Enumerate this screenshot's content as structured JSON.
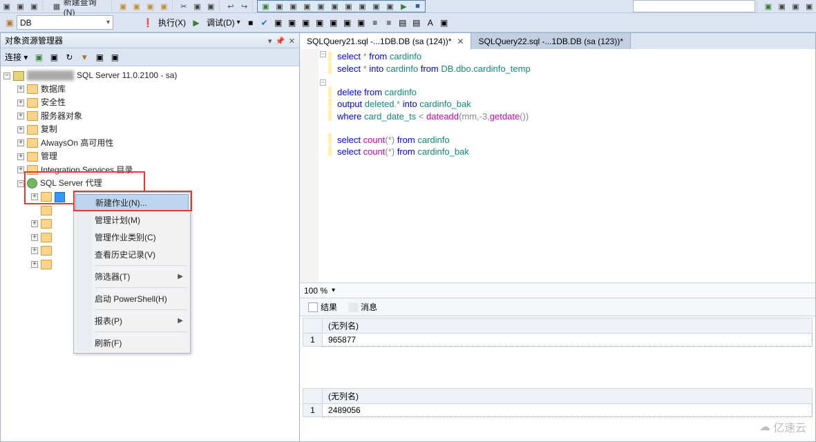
{
  "top_toolbar": {
    "new_query_label": "新建查询(N)",
    "dropdown_value": "DB",
    "execute_label": "执行(X)",
    "debug_label": "调试(D)"
  },
  "object_explorer": {
    "title": "对象资源管理器",
    "connect_label": "连接 ▾",
    "root_server": "SQL Server 11.0.2100 - sa)",
    "nodes": [
      "数据库",
      "安全性",
      "服务器对象",
      "复制",
      "AlwaysOn 高可用性",
      "管理",
      "Integration Services 目录",
      "SQL Server 代理"
    ]
  },
  "context_menu": {
    "items": {
      "new_job": "新建作业(N)...",
      "manage_plan": "管理计划(M)",
      "manage_category": "管理作业类别(C)",
      "history": "查看历史记录(V)",
      "filter": "筛选器(T)",
      "powershell": "启动 PowerShell(H)",
      "reports": "报表(P)",
      "refresh": "刷新(F)"
    }
  },
  "tabs": {
    "t1": "SQLQuery21.sql -...1DB.DB (sa (124))*",
    "t2": "SQLQuery22.sql -...1DB.DB (sa (123))*"
  },
  "code_tokens": {
    "l1": {
      "kw1": "select",
      "s": " * ",
      "kw2": "from",
      "id": " cardinfo"
    },
    "l2": {
      "kw1": "select",
      "s": " * ",
      "kw2": "into",
      "id1": " cardinfo ",
      "kw3": "from",
      "id2": " DB.dbo.cardinfo_temp"
    },
    "l3": {
      "kw1": "delete",
      "kw2": " from",
      "id": " cardinfo"
    },
    "l4": {
      "kw1": "output",
      "id1": " deleted",
      "s1": ".* ",
      "kw2": "into",
      "id2": " cardinfo_bak"
    },
    "l5": {
      "kw1": "where",
      "id1": " card_date_ts ",
      "op": "<",
      "fn": " dateadd",
      "p": "(mm,-3,",
      "fn2": "getdate",
      "p2": "())"
    },
    "l6": {
      "kw1": "select",
      "fn": " count",
      "p1": "(*) ",
      "kw2": "from",
      "id": " cardinfo"
    },
    "l7": {
      "kw1": "select",
      "fn": " count",
      "p1": "(*) ",
      "kw2": "from",
      "id": " cardinfo_bak"
    }
  },
  "zoom_level": "100 %",
  "results_tabs": {
    "results": "结果",
    "messages": "消息"
  },
  "grid1": {
    "header": "(无列名)",
    "rownum": "1",
    "value": "965877"
  },
  "grid2": {
    "header": "(无列名)",
    "rownum": "1",
    "value": "2489056"
  },
  "watermark": "亿速云"
}
